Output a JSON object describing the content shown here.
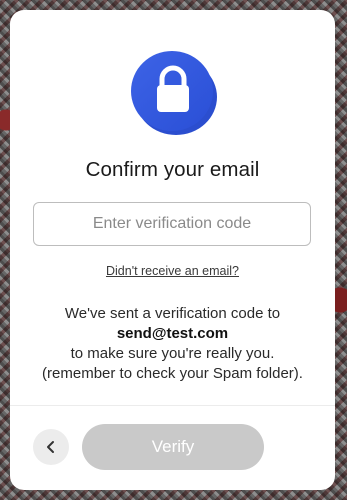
{
  "dialog": {
    "title": "Confirm your email",
    "icon": "lock-icon",
    "accent_color": "#3a5ee0",
    "code_input": {
      "value": "",
      "placeholder": "Enter verification code"
    },
    "resend_link": "Didn't receive an email?",
    "message": {
      "line1": "We've sent a verification code to",
      "email": "send@test.com",
      "line2": "to make sure you're really you.",
      "line3": "(remember to check your Spam folder)."
    },
    "footer": {
      "back_icon": "chevron-left-icon",
      "verify_label": "Verify",
      "verify_disabled": true,
      "verify_color": "#c9c9c9"
    }
  }
}
